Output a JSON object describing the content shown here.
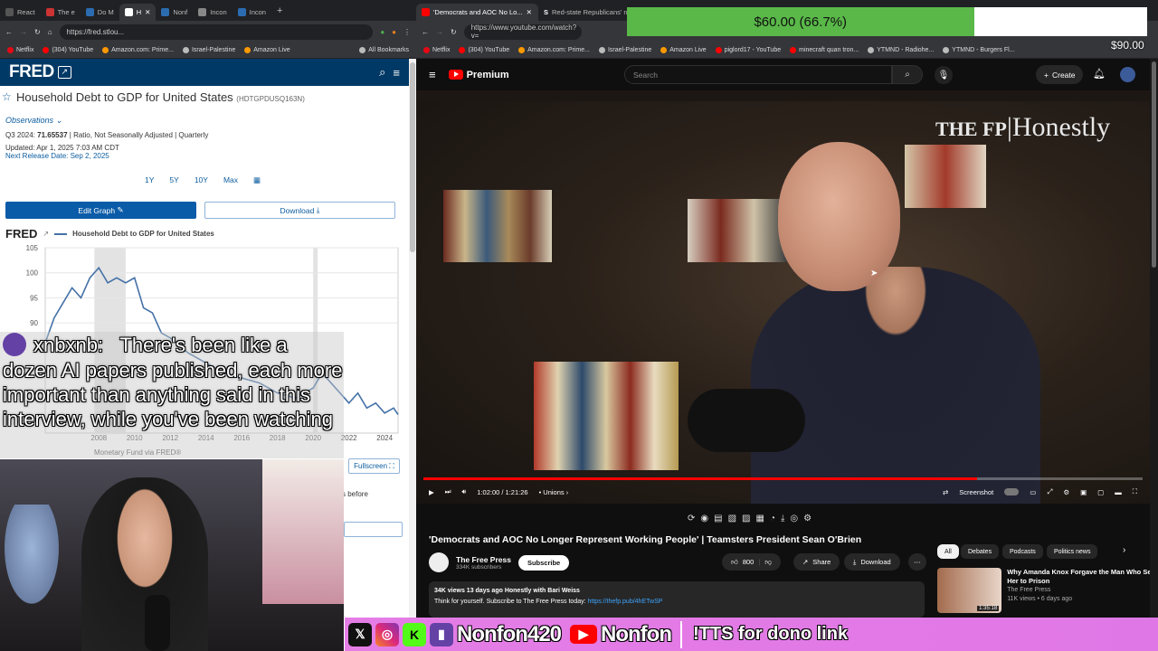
{
  "left_browser": {
    "tabs": [
      {
        "label": "React"
      },
      {
        "label": "The e"
      },
      {
        "label": "Do M"
      },
      {
        "label": "H",
        "active": true
      },
      {
        "label": "Nonf"
      },
      {
        "label": "Incon"
      },
      {
        "label": "Incon"
      }
    ],
    "url": "https://fred.stlou...",
    "bookmarks": [
      "Netflix",
      "(304) YouTube",
      "Amazon.com: Prime...",
      "Israel-Palestine",
      "Amazon Live",
      "All Bookmarks"
    ],
    "fred": {
      "logo": "FRED",
      "series_title": "Household Debt to GDP for United States",
      "series_id": "(HDTGPDUSQ163N)",
      "observations_label": "Observations",
      "obs_period": "Q3 2024:",
      "obs_value": "71.65537",
      "obs_units": "| Ratio, Not Seasonally Adjusted | Quarterly",
      "updated": "Updated: Apr 1, 2025 7:03 AM CDT",
      "next_release": "Next Release Date: Sep 2, 2025",
      "range_buttons": [
        "1Y",
        "5Y",
        "10Y",
        "Max"
      ],
      "edit_graph": "Edit Graph",
      "download": "Download",
      "chart_logo": "FRED",
      "legend_label": "Household Debt to GDP for United States",
      "source_text": "Monetary Fund via FRED®",
      "fullscreen": "Fullscreen",
      "side_text": "s before"
    }
  },
  "chart_data": {
    "type": "line",
    "title": "",
    "xlabel": "",
    "ylabel": "",
    "x_ticks": [
      "2008",
      "2010",
      "2012",
      "2014",
      "2016",
      "2018",
      "2020",
      "2022",
      "2024"
    ],
    "y_ticks": [
      90,
      95,
      100,
      105
    ],
    "ylim": [
      68,
      105
    ],
    "xlim": [
      2005.0,
      2024.75
    ],
    "series": [
      {
        "name": "Household Debt to GDP for United States",
        "x": [
          2005.0,
          2005.5,
          2006.0,
          2006.5,
          2007.0,
          2007.5,
          2008.0,
          2008.5,
          2009.0,
          2009.5,
          2010.0,
          2010.5,
          2011.0,
          2011.5,
          2012.0,
          2013.0,
          2014.0,
          2015.0,
          2016.0,
          2017.0,
          2018.0,
          2019.0,
          2020.0,
          2020.5,
          2021.0,
          2022.0,
          2022.5,
          2023.0,
          2023.5,
          2024.0,
          2024.5,
          2024.75
        ],
        "values": [
          86,
          91,
          94,
          97,
          95,
          99,
          101,
          98,
          99,
          98,
          99,
          93,
          92,
          88,
          87,
          84,
          82,
          80,
          79,
          78,
          76,
          75,
          77,
          80,
          78,
          74,
          76,
          73,
          74,
          72,
          73,
          71.7
        ]
      }
    ],
    "recession_bands": [
      [
        2007.75,
        2009.5
      ],
      [
        2020.0,
        2020.25
      ]
    ],
    "grid": true,
    "legend": "top-left"
  },
  "right_browser": {
    "tabs": [
      {
        "label": "'Democrats and AOC No Lo...",
        "active": true
      },
      {
        "label": "Red-state Republicans' ne"
      }
    ],
    "url": "https://www.youtube.com/watch?v=",
    "bookmarks": [
      "Netflix",
      "(304) YouTube",
      "Amazon.com: Prime...",
      "Israel-Palestine",
      "Amazon Live",
      "piglord17 - YouTube",
      "minecraft quan tron...",
      "YTMND - Radiohe...",
      "YTMND - Burgers Fl..."
    ],
    "youtube": {
      "logo": "Premium",
      "search_placeholder": "Search",
      "create": "Create",
      "video_watermark": "Honestly",
      "video_watermark_prefix": "THE FP",
      "time": "1:02:00 / 1:21:26",
      "chapter": "Unions",
      "screenshot_label": "Screenshot",
      "progress": 0.77,
      "title": "'Democrats and AOC No Longer Represent Working People' | Teamsters President Sean O'Brien",
      "channel_name": "The Free Press",
      "subscribers": "334K subscribers",
      "subscribe": "Subscribe",
      "likes": "800",
      "share": "Share",
      "download": "Download",
      "desc_stats": "34K views  13 days ago  Honestly with Bari Weiss",
      "desc_line": "Think for yourself. Subscribe to The Free Press today:",
      "desc_link": "https://thefp.pub/4hETwSP",
      "chips": [
        "All",
        "Debates",
        "Podcasts",
        "Politics news"
      ],
      "rec_title": "Why Amanda Knox Forgave the Man Who Sent Her to Prison",
      "rec_channel": "The Free Press",
      "rec_meta": "11K views • 6 days ago",
      "rec_duration": "1:35:18"
    }
  },
  "overlays": {
    "donation_goal": "$60.00 (66.7%)",
    "donation_fraction": 0.667,
    "donation_target": "$90.00",
    "tts_user": "xnbxnb:",
    "tts_message": "There's been like a dozen AI papers published, each more important than anything said in this interview, while you've been watching",
    "social_handle_1": "Nonfon420",
    "social_handle_2": "Nonfon",
    "tts_note": "!TTS for dono link"
  },
  "colors": {
    "fred_blue": "#003966",
    "chart_line": "#4572a7",
    "yt_red": "#ff0000",
    "donation_green": "#59b848",
    "social_pink": "#e57de6"
  }
}
